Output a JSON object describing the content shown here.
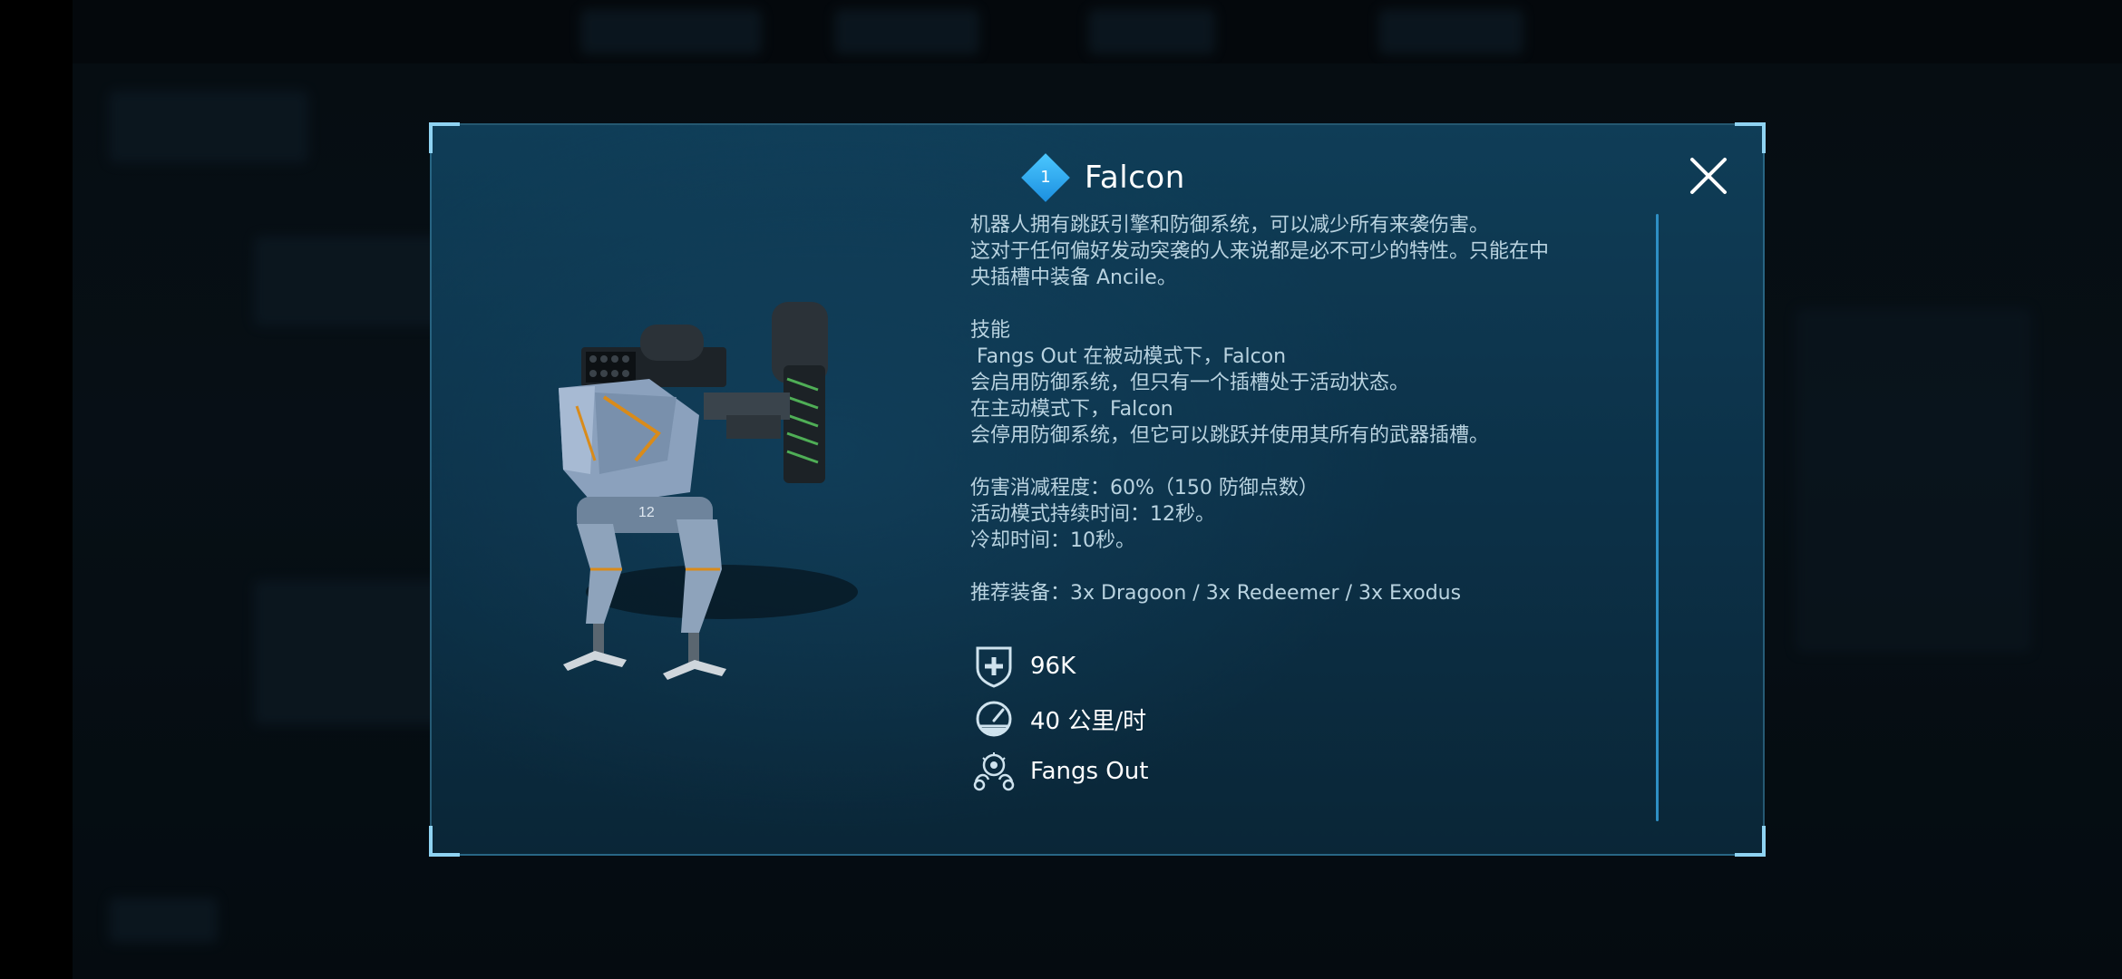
{
  "robot": {
    "rank": "1",
    "name": "Falcon",
    "description": "机器人拥有跳跃引擎和防御系统，可以减少所有来袭伤害。\n这对于任何偏好发动突袭的人来说都是必不可少的特性。只能在中\n央插槽中装备 Ancile。\n\n技能\n Fangs Out 在被动模式下，Falcon\n会启用防御系统，但只有一个插槽处于活动状态。\n在主动模式下，Falcon\n会停用防御系统，但它可以跳跃并使用其所有的武器插槽。\n\n伤害消减程度：60%（150 防御点数）\n活动模式持续时间：12秒。\n冷却时间：10秒。\n\n推荐装备：3x Dragoon / 3x Redeemer / 3x Exodus",
    "stats": {
      "health": "96K",
      "speed": "40 公里/时",
      "ability": "Fangs Out"
    }
  },
  "icons": {
    "close": "close-icon",
    "health": "shield-plus-icon",
    "speed": "speedometer-icon",
    "ability": "ability-icon"
  },
  "colors": {
    "accent": "#2e8fc4",
    "rank_badge": "#36aef0",
    "frame_corner": "#8fd3f2"
  }
}
